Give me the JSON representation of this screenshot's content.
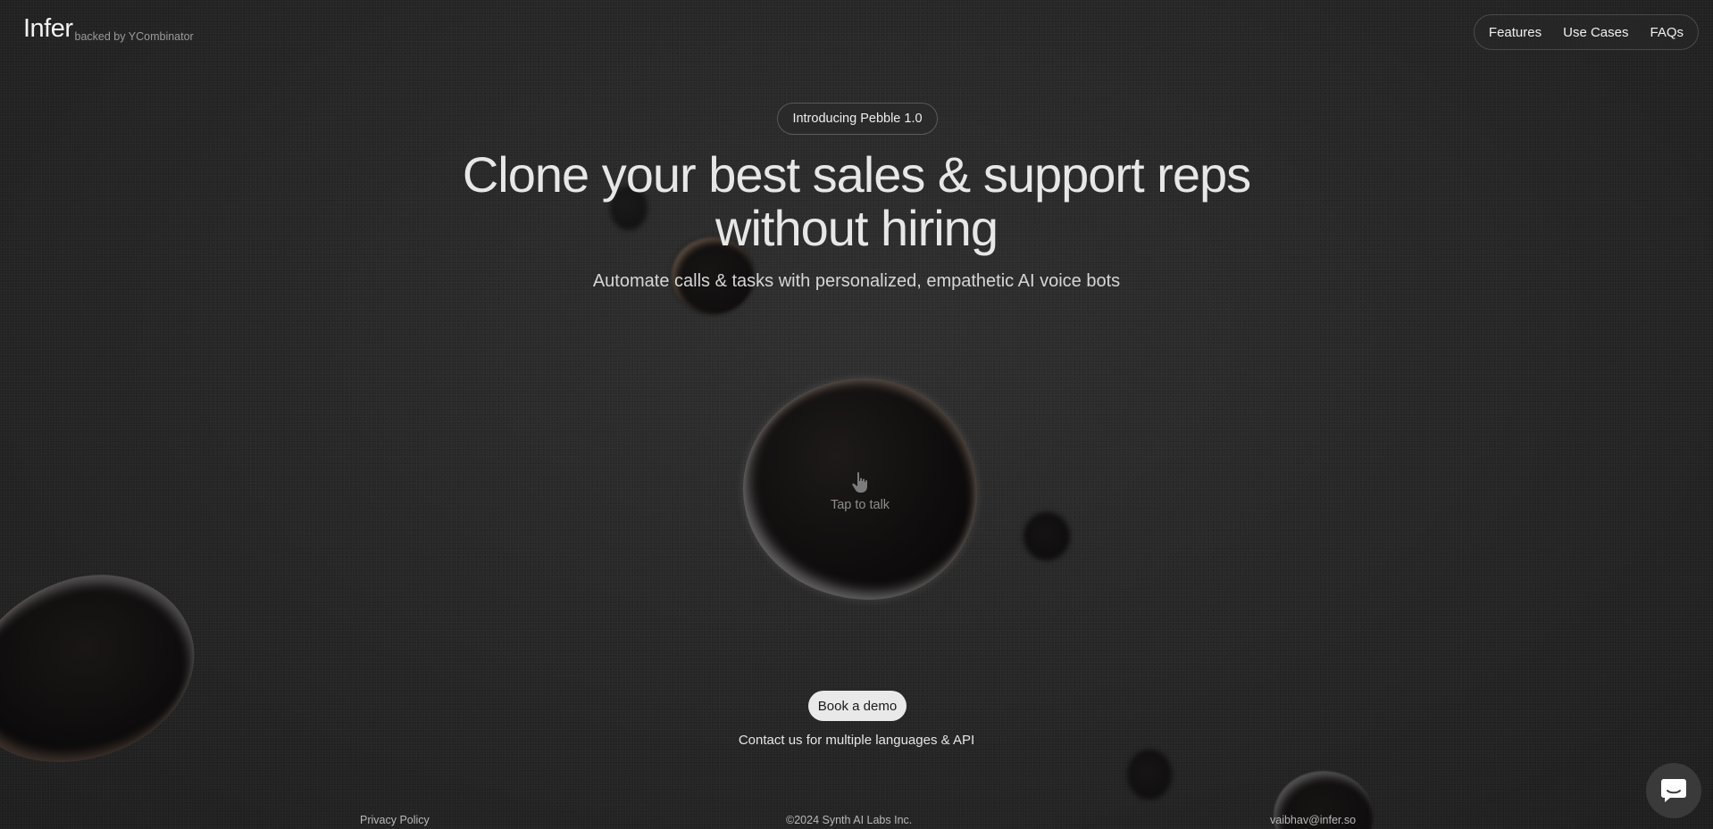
{
  "brand": {
    "name": "Infer",
    "tagline": "backed by YCombinator"
  },
  "nav": {
    "items": [
      {
        "label": "Features"
      },
      {
        "label": "Use Cases"
      },
      {
        "label": "FAQs"
      }
    ]
  },
  "hero": {
    "announcement": "Introducing Pebble 1.0",
    "headline_line1": "Clone your best sales & support reps",
    "headline_line2": "without hiring",
    "subheadline": "Automate calls & tasks with personalized, empathetic AI voice bots"
  },
  "voice_orb": {
    "icon": "pointing-hand-icon",
    "label": "Tap to talk"
  },
  "cta": {
    "button_label": "Book a demo",
    "note": "Contact us for multiple languages & API"
  },
  "footer": {
    "privacy": "Privacy Policy",
    "copyright": "©2024 Synth AI Labs Inc.",
    "email": "vaibhav@infer.so"
  },
  "chat_widget": {
    "icon": "chat-bubble-icon"
  },
  "colors": {
    "background": "#272727",
    "text_primary": "#e7e7e7",
    "button_bg": "#e9e9e9",
    "button_text": "#1a1a1a"
  }
}
